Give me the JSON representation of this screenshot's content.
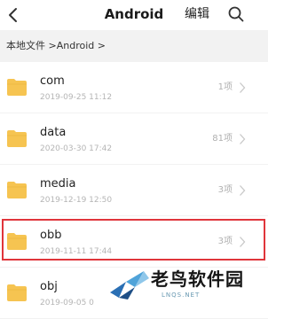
{
  "header": {
    "title": "Android",
    "edit_label": "编辑",
    "back_icon": "chevron-left-icon",
    "search_icon": "search-icon"
  },
  "breadcrumb": {
    "path": "本地文件 >Android >"
  },
  "folders": [
    {
      "name": "com",
      "date": "2019-09-25 11:12",
      "count": "1项"
    },
    {
      "name": "data",
      "date": "2020-03-30 17:42",
      "count": "81项"
    },
    {
      "name": "media",
      "date": "2019-12-19 12:50",
      "count": "3项"
    },
    {
      "name": "obb",
      "date": "2019-11-11 17:44",
      "count": "3项",
      "highlighted": true
    },
    {
      "name": "obj",
      "date": "2019-09-05 0",
      "count": ""
    }
  ],
  "watermark": {
    "text": "老鸟软件园",
    "subtext": "LNQS.NET"
  },
  "colors": {
    "folder": "#f6c451",
    "highlight_border": "#e0353b",
    "breadcrumb_bg": "#f2f2f2"
  }
}
